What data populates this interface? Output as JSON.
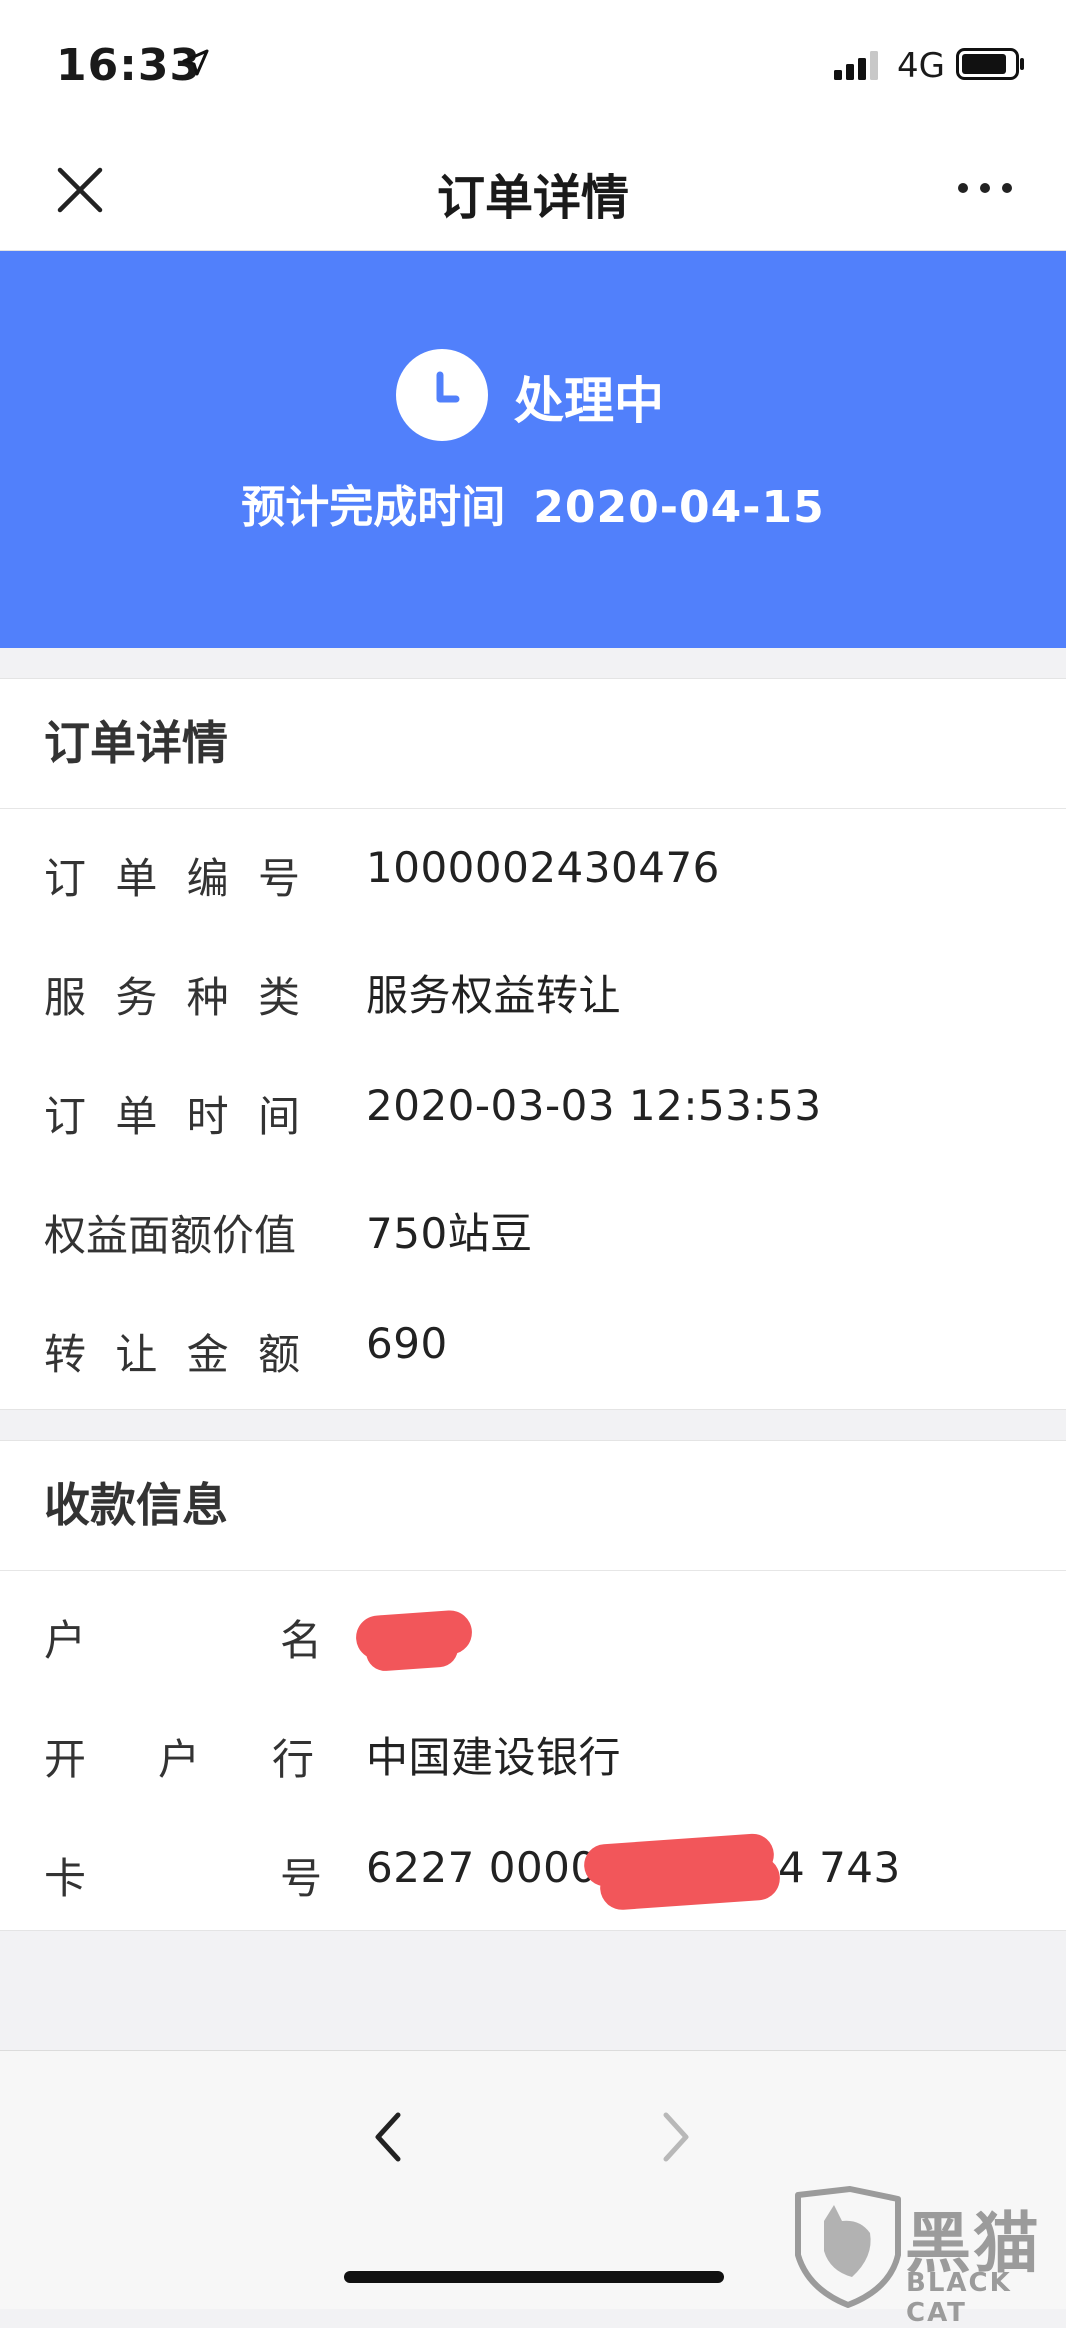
{
  "status_bar": {
    "time": "16:33",
    "network": "4G"
  },
  "navbar": {
    "title": "订单详情"
  },
  "banner": {
    "status": "处理中",
    "eta_label": "预计完成时间",
    "eta_date": "2020-04-15",
    "color": "#5180fb"
  },
  "order_details": {
    "title": "订单详情",
    "rows": [
      {
        "label": [
          "订",
          "单",
          "编",
          "号"
        ],
        "value": "1000002430476"
      },
      {
        "label": [
          "服",
          "务",
          "种",
          "类"
        ],
        "value": "服务权益转让"
      },
      {
        "label": [
          "订",
          "单",
          "时",
          "间"
        ],
        "value": "2020-03-03 12:53:53"
      },
      {
        "label": [
          "权益面额价值"
        ],
        "value": "750站豆"
      },
      {
        "label": [
          "转",
          "让",
          "金",
          "额"
        ],
        "value": "690"
      }
    ]
  },
  "payee_info": {
    "title": "收款信息",
    "rows": [
      {
        "label": [
          "户",
          "名"
        ],
        "value": ""
      },
      {
        "label": [
          "开",
          "户",
          "行"
        ],
        "value": "中国建设银行"
      },
      {
        "label": [
          "卡",
          "号"
        ],
        "value_start": "6227 0000",
        "value_end": "4 743"
      }
    ]
  },
  "watermark": {
    "cn": "黑猫",
    "en": "BLACK CAT"
  }
}
